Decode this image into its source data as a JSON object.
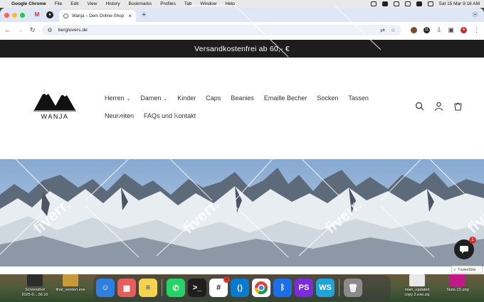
{
  "menubar": {
    "app_name": "Google Chrome",
    "items": [
      "File",
      "Edit",
      "View",
      "History",
      "Bookmarks",
      "Profiles",
      "Tab",
      "Window",
      "Help"
    ],
    "clock": "Sat 15 Mar  9:16 AM"
  },
  "browser": {
    "tab_title": "Wanja – Dein Online-Shop f...",
    "url": "berglovers.de",
    "profile_initial": "A",
    "ext_badge": "11"
  },
  "site": {
    "announcement": "Versandkostenfrei ab 60,- €",
    "logo_text": "WANJA",
    "nav_row1": [
      "Herren",
      "Damen",
      "Kinder",
      "Caps",
      "Beanies",
      "Emaille Becher",
      "Socken",
      "Tassen"
    ],
    "nav_row2": [
      "Neuheiten",
      "FAQs und Kontakt"
    ],
    "chat_badge": "1",
    "trusted_label": "TrustedSite"
  },
  "watermark": "fiverr.",
  "desktop": {
    "files_left": [
      {
        "label_1": "Screenshot",
        "label_2": "2025-0....56.10"
      },
      {
        "label_1": "",
        "label_2": "final_version.exe"
      }
    ],
    "files_right": [
      {
        "label_1": "main_updated",
        "label_2": "copy 2.exe.zip"
      },
      {
        "label_1": "",
        "label_2": "Siata (3).png"
      }
    ],
    "dock_badge": "1"
  },
  "colors": {
    "announcement_bg": "#1d1d1d",
    "tabbar_bg": "#dfe6f5",
    "omnibox_bg": "#eef1f8"
  }
}
